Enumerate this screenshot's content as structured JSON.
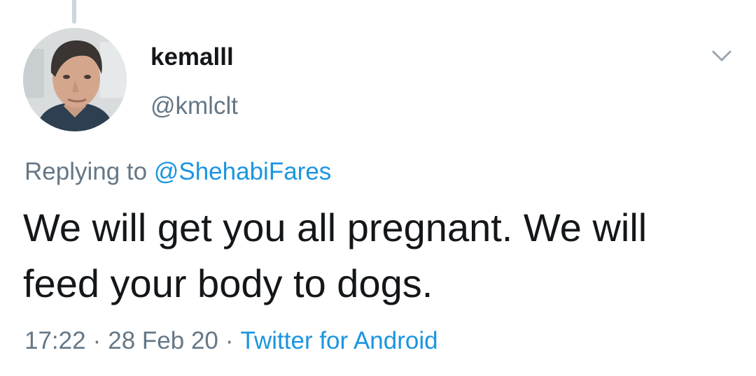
{
  "tweet": {
    "author": {
      "display_name": "kemalll",
      "handle": "@kmlclt",
      "avatar": "profile-photo-man"
    },
    "reply": {
      "prefix": "Replying to",
      "mention": "@ShehabiFares"
    },
    "text": "We will get you all pregnant. We will feed your body to dogs.",
    "meta": {
      "time": "17:22",
      "separator": "·",
      "date": "28 Feb 20",
      "source": "Twitter for Android"
    },
    "menu_icon": "chevron-down-icon"
  },
  "colors": {
    "text_primary": "#14171a",
    "text_secondary": "#657786",
    "link": "#1b95e0",
    "thread_line": "#ccd6dd"
  }
}
